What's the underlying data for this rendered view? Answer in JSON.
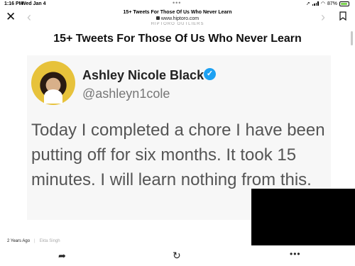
{
  "status_bar": {
    "time": "1:16 PM",
    "date": "Wed Jan 4",
    "battery_percent": "87%",
    "battery_level": 0.87,
    "battery_color": "#7bd24f"
  },
  "browser": {
    "page_title": "15+ Tweets For Those Of Us Who Never Learn",
    "url": "www.hiptoro.com",
    "close_icon": "close-icon",
    "bookmark_icon": "bookmark-icon"
  },
  "site_label": "HIPTORO OUTLIERS",
  "article": {
    "title": "15+ Tweets For Those Of Us Who Never Learn"
  },
  "tweet": {
    "author_name": "Ashley Nicole Black",
    "handle": "@ashleyn1cole",
    "text": "Today I completed a chore I have been putting off for six months. It took 15 minutes. I will learn nothing from this.",
    "verified_color": "#1da1f2"
  },
  "meta": {
    "age": "2 Years Ago",
    "separator": "|",
    "author": "Ekta Singh"
  },
  "toolbar": {
    "share_icon": "share-icon",
    "reload_icon": "reload-icon",
    "more_icon": "more-icon"
  }
}
